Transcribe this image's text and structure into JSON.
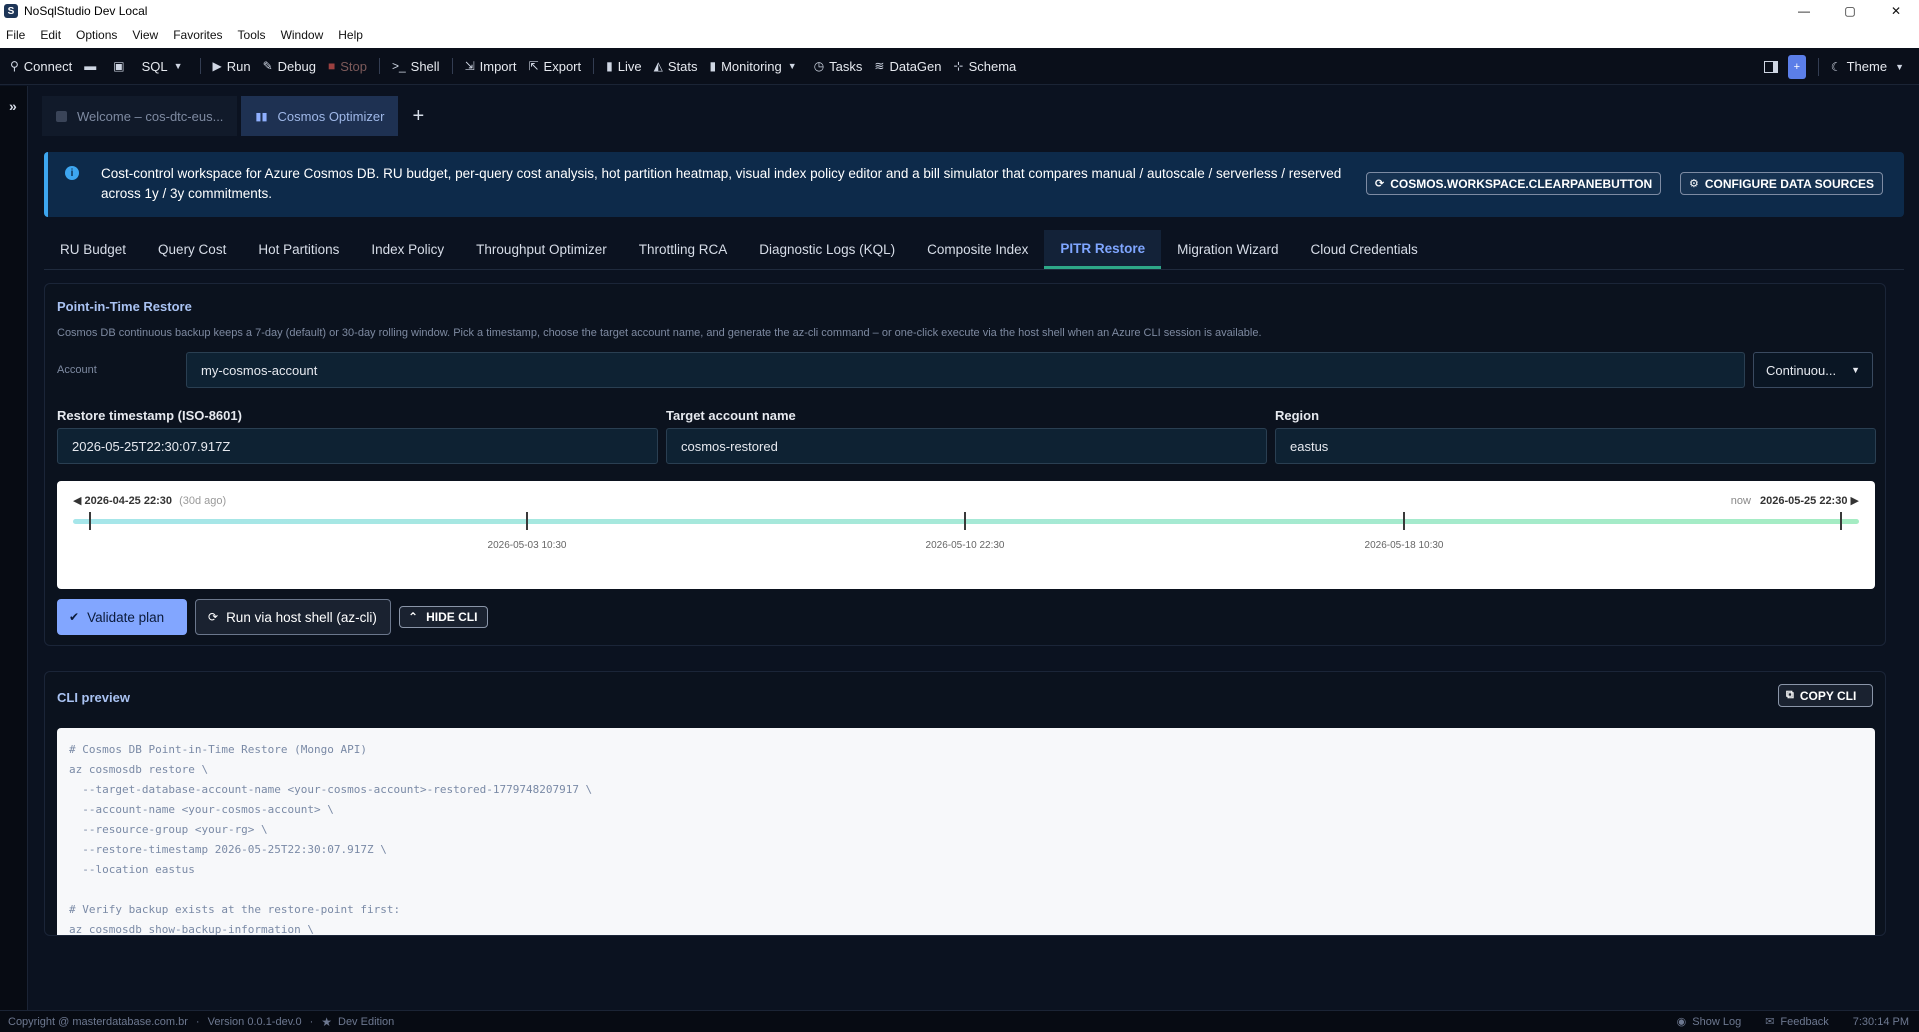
{
  "window": {
    "title": "NoSqlStudio Dev Local",
    "app_icon": "S",
    "controls": [
      "—",
      "▢",
      "✕"
    ]
  },
  "menu": [
    "File",
    "Edit",
    "Options",
    "View",
    "Favorites",
    "Tools",
    "Window",
    "Help"
  ],
  "toolbar": {
    "connect": "Connect",
    "sql": "SQL",
    "run": "Run",
    "debug": "Debug",
    "stop": "Stop",
    "shell": "Shell",
    "import": "Import",
    "export": "Export",
    "live": "Live",
    "stats": "Stats",
    "monitoring": "Monitoring",
    "tasks": "Tasks",
    "datagen": "DataGen",
    "schema": "Schema",
    "theme": "Theme",
    "accent_btn": "+"
  },
  "doc_tabs": [
    {
      "label": "Welcome – cos-dtc-eus...",
      "active": false
    },
    {
      "label": "Cosmos Optimizer",
      "active": true
    }
  ],
  "banner": {
    "text": "Cost-control workspace for Azure Cosmos DB. RU budget, per-query cost analysis, hot partition heatmap, visual index policy editor and a bill simulator that compares manual / autoscale / serverless / reserved across 1y / 3y commitments.",
    "clear_button": "COSMOS.WORKSPACE.CLEARPANEBUTTON",
    "configure_button": "CONFIGURE DATA SOURCES"
  },
  "module_tabs": [
    {
      "label": "RU Budget",
      "active": false
    },
    {
      "label": "Query Cost",
      "active": false
    },
    {
      "label": "Hot Partitions",
      "active": false
    },
    {
      "label": "Index Policy",
      "active": false
    },
    {
      "label": "Throughput Optimizer",
      "active": false
    },
    {
      "label": "Throttling RCA",
      "active": false
    },
    {
      "label": "Diagnostic Logs (KQL)",
      "active": false
    },
    {
      "label": "Composite Index",
      "active": false
    },
    {
      "label": "PITR Restore",
      "active": true
    },
    {
      "label": "Migration Wizard",
      "active": false
    },
    {
      "label": "Cloud Credentials",
      "active": false
    }
  ],
  "pitr": {
    "title": "Point-in-Time Restore",
    "description": "Cosmos DB continuous backup keeps a 7-day (default) or 30-day rolling window. Pick a timestamp, choose the target account name, and generate the az-cli command – or one-click execute via the host shell when an Azure CLI session is available.",
    "account_label": "Account",
    "account_value": "my-cosmos-account",
    "backup_mode": "Continuou...",
    "timestamp_label": "Restore timestamp (ISO-8601)",
    "timestamp_value": "2026-05-25T22:30:07.917Z",
    "target_label": "Target account name",
    "target_value": "cosmos-restored",
    "region_label": "Region",
    "region_value": "eastus",
    "timeline": {
      "start": "2026-04-25 22:30",
      "start_ago": "(30d ago)",
      "now_label": "now",
      "end": "2026-05-25 22:30",
      "ticks": [
        "2026-05-03 10:30",
        "2026-05-10 22:30",
        "2026-05-18 10:30"
      ]
    },
    "validate_button": "Validate plan",
    "run_button": "Run via host shell (az-cli)",
    "hide_cli_button": "HIDE CLI"
  },
  "cli": {
    "title": "CLI preview",
    "copy_button": "COPY CLI",
    "lines": [
      "# Cosmos DB Point-in-Time Restore (Mongo API)",
      "az cosmosdb restore \\",
      "  --target-database-account-name <your-cosmos-account>-restored-1779748207917 \\",
      "  --account-name <your-cosmos-account> \\",
      "  --resource-group <your-rg> \\",
      "  --restore-timestamp 2026-05-25T22:30:07.917Z \\",
      "  --location eastus",
      "",
      "# Verify backup exists at the restore-point first:",
      "az cosmosdb show-backup-information \\"
    ]
  },
  "status": {
    "copyright": "Copyright @ masterdatabase.com.br",
    "version": "Version 0.0.1-dev.0",
    "edition": "Dev Edition",
    "show_log": "Show Log",
    "feedback": "Feedback",
    "time": "7:30:14 PM"
  }
}
